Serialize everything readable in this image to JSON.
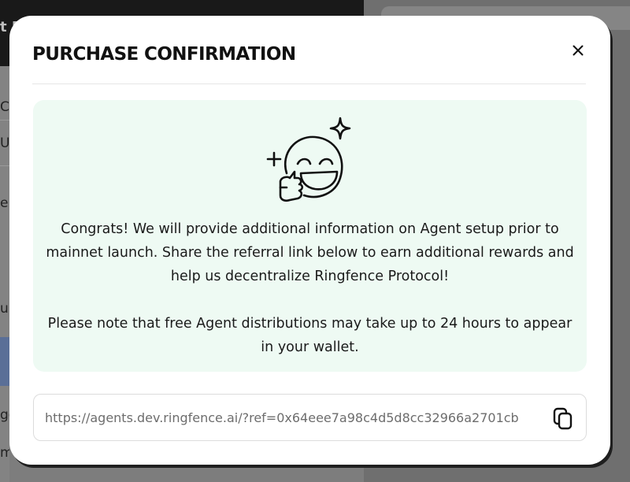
{
  "background": {
    "header_text": "t F",
    "fragments": [
      "C",
      "US",
      "e",
      "ur",
      "ge",
      "mi"
    ]
  },
  "modal": {
    "title": "PURCHASE CONFIRMATION",
    "close_icon": "close-icon",
    "illustration_icon": "happy-thumbs-up-face-icon",
    "message_paragraph_1": "Congrats! We will provide additional information on Agent setup prior to mainnet launch. Share the referral link below to earn additional rewards and help us decentralize Ringfence Protocol!",
    "message_paragraph_2": "Please note that free Agent distributions may take up to 24 hours to appear in your wallet.",
    "referral_link": "https://agents.dev.ringfence.ai/?ref=0x64eee7a98c4d5d8cc32966a2701cb",
    "copy_icon": "copy-icon"
  },
  "colors": {
    "info_box_bg": "#eefaf3",
    "modal_bg": "#ffffff",
    "backdrop": "#7d7d7d"
  }
}
